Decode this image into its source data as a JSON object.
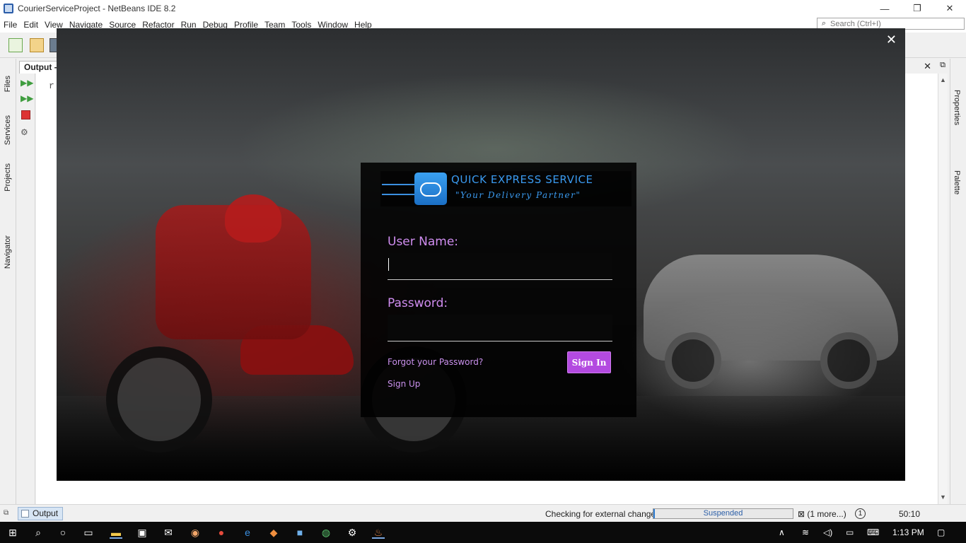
{
  "window": {
    "title": "CourierServiceProject - NetBeans IDE 8.2",
    "minimize": "—",
    "restore": "❐",
    "close": "✕"
  },
  "menu": [
    "File",
    "Edit",
    "View",
    "Navigate",
    "Source",
    "Refactor",
    "Run",
    "Debug",
    "Profile",
    "Team",
    "Tools",
    "Window",
    "Help"
  ],
  "search": {
    "placeholder": "Search (Ctrl+I)"
  },
  "left_tabs": [
    "Files",
    "Services",
    "Projects",
    "Navigator"
  ],
  "right_tabs": [
    "Properties",
    "Palette"
  ],
  "output_panel": {
    "tab_label": "Output -",
    "close": "✕",
    "text": "r"
  },
  "login": {
    "close": "✕",
    "brand_name": "QUICK EXPRESS SERVICE",
    "tagline": "\"Your Delivery Partner\"",
    "username_label": "User Name:",
    "username_value": "",
    "password_label": "Password:",
    "password_value": "",
    "forgot_link": "Forgot your Password?",
    "signup_link": "Sign Up",
    "signin_button": "Sign In",
    "accent": "#b34ae0",
    "label_color": "#d08df0"
  },
  "statusbar": {
    "output_button": "Output",
    "checking": "Checking for external changes",
    "progress_label": "Suspended",
    "more": "(1 more...)",
    "badge": "1",
    "position": "50:10"
  },
  "taskbar": {
    "time": "1:13 PM",
    "icons": [
      "start-icon",
      "search-icon",
      "cortana-icon",
      "task-view-icon",
      "file-explorer-icon",
      "store-icon",
      "mail-icon",
      "paint-icon",
      "chrome-icon",
      "edge-icon",
      "git-icon",
      "virtualbox-icon",
      "whatsapp-icon",
      "settings-icon",
      "java-icon"
    ]
  }
}
